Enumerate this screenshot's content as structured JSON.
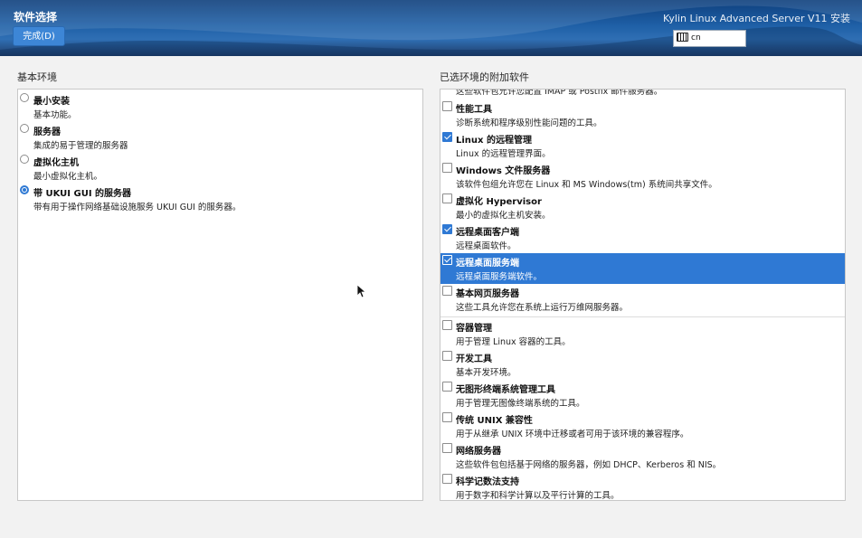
{
  "header": {
    "title": "软件选择",
    "done_label": "完成(D)",
    "product": "Kylin Linux Advanced Server V11 安装",
    "keyboard_layout": "cn"
  },
  "base_env": {
    "label": "基本环境",
    "items": [
      {
        "name": "最小安装",
        "desc": "基本功能。",
        "selected": false
      },
      {
        "name": "服务器",
        "desc": "集成的易于管理的服务器",
        "selected": false
      },
      {
        "name": "虚拟化主机",
        "desc": "最小虚拟化主机。",
        "selected": false
      },
      {
        "name": "带 UKUI GUI 的服务器",
        "desc": "带有用于操作网络基础设施服务 UKUI GUI 的服务器。",
        "selected": true
      }
    ]
  },
  "addons": {
    "label": "已选环境的附加软件",
    "cut_off_text": "这些软件包允许您配置 IMAP 或 Postfix 邮件服务器。",
    "items": [
      {
        "name": "性能工具",
        "desc": "诊断系统和程序级别性能问题的工具。",
        "checked": false
      },
      {
        "name": "Linux 的远程管理",
        "desc": "Linux 的远程管理界面。",
        "checked": true
      },
      {
        "name": "Windows 文件服务器",
        "desc": "该软件包组允许您在 Linux 和 MS Windows(tm) 系统间共享文件。",
        "checked": false
      },
      {
        "name": "虚拟化 Hypervisor",
        "desc": "最小的虚拟化主机安装。",
        "checked": false
      },
      {
        "name": "远程桌面客户端",
        "desc": "远程桌面软件。",
        "checked": true
      },
      {
        "name": "远程桌面服务端",
        "desc": "远程桌面服务端软件。",
        "checked": true,
        "highlighted": true
      },
      {
        "name": "基本网页服务器",
        "desc": "这些工具允许您在系统上运行万维网服务器。",
        "checked": false
      },
      {
        "name": "容器管理",
        "desc": "用于管理 Linux 容器的工具。",
        "checked": false
      },
      {
        "name": "开发工具",
        "desc": "基本开发环境。",
        "checked": false
      },
      {
        "name": "无图形终端系统管理工具",
        "desc": "用于管理无图像终端系统的工具。",
        "checked": false
      },
      {
        "name": "传统 UNIX 兼容性",
        "desc": "用于从继承 UNIX 环境中迁移或者可用于该环境的兼容程序。",
        "checked": false
      },
      {
        "name": "网络服务器",
        "desc": "这些软件包包括基于网络的服务器，例如 DHCP、Kerberos 和 NIS。",
        "checked": false
      },
      {
        "name": "科学记数法支持",
        "desc": "用于数字和科学计算以及平行计算的工具。",
        "checked": false
      }
    ]
  },
  "colors": {
    "accent": "#2f79d4",
    "header": "#1e5fa6"
  }
}
